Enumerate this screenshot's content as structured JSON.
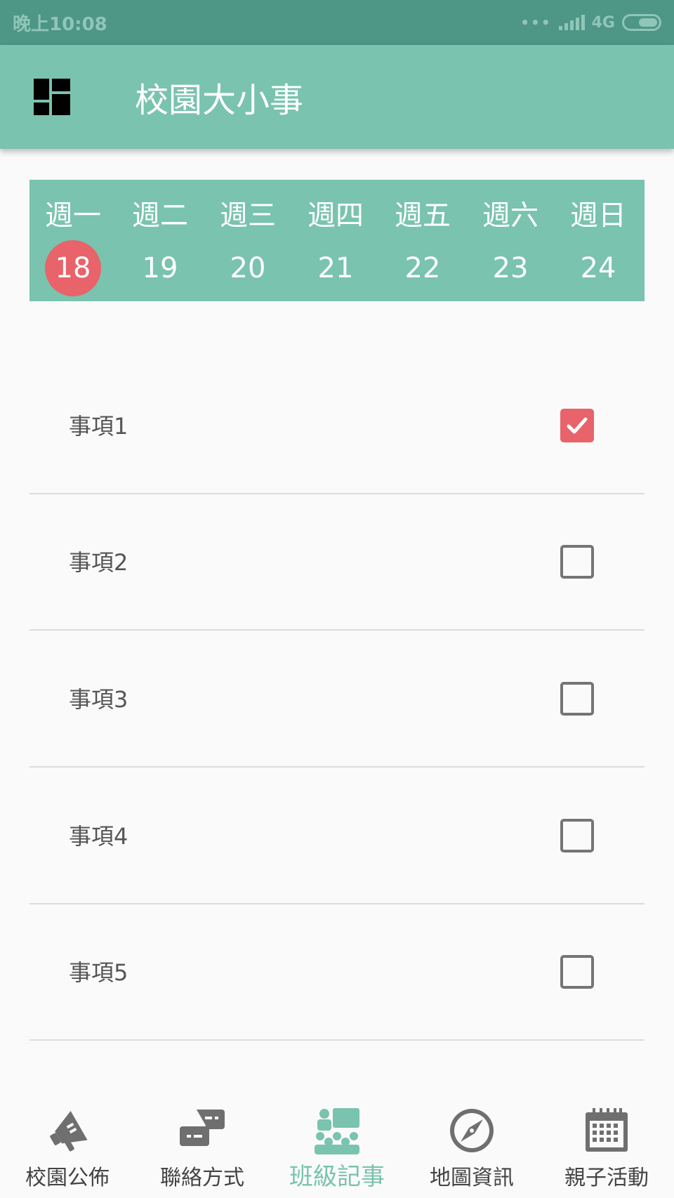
{
  "status_bar": {
    "time": "晚上10:08",
    "network": "4G"
  },
  "app_bar": {
    "title": "校園大小事",
    "menu_icon": "dashboard-icon"
  },
  "week": {
    "days": [
      "週一",
      "週二",
      "週三",
      "週四",
      "週五",
      "週六",
      "週日"
    ],
    "dates": [
      "18",
      "19",
      "20",
      "21",
      "22",
      "23",
      "24"
    ],
    "selected_index": 0
  },
  "items": [
    {
      "label": "事項1",
      "checked": true
    },
    {
      "label": "事項2",
      "checked": false
    },
    {
      "label": "事項3",
      "checked": false
    },
    {
      "label": "事項4",
      "checked": false
    },
    {
      "label": "事項5",
      "checked": false
    }
  ],
  "bottom_nav": [
    {
      "label": "校園公佈",
      "icon": "megaphone-icon",
      "active": false
    },
    {
      "label": "聯絡方式",
      "icon": "chat-icon",
      "active": false
    },
    {
      "label": "班級記事",
      "icon": "class-icon",
      "active": true
    },
    {
      "label": "地圖資訊",
      "icon": "compass-icon",
      "active": false
    },
    {
      "label": "親子活動",
      "icon": "calendar-icon",
      "active": false
    }
  ],
  "colors": {
    "primary": "#7ac3ae",
    "status_bar": "#4e9686",
    "accent": "#e8636a",
    "icon_gray": "#6f6f6f"
  }
}
